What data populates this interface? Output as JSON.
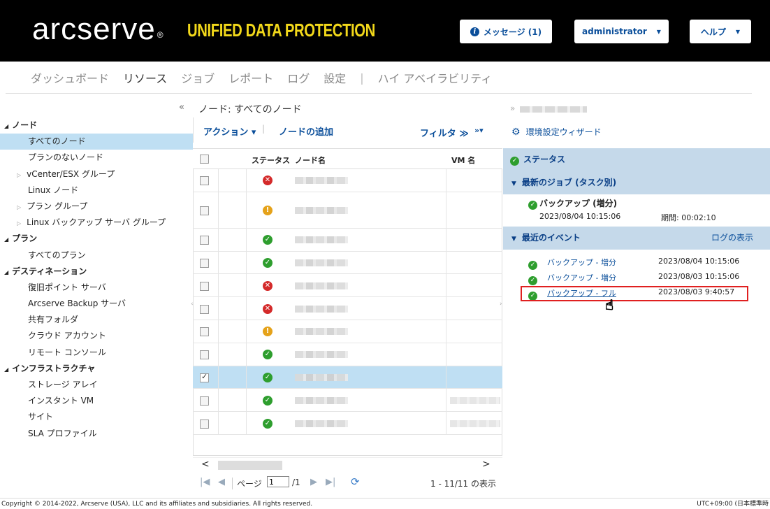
{
  "header": {
    "logo": "arcserve",
    "logo_mark": "®",
    "product": "UNIFIED DATA PROTECTION",
    "messages_label": "メッセージ (1)",
    "user_label": "administrator",
    "help_label": "ヘルプ"
  },
  "menu": {
    "items": [
      "ダッシュボード",
      "リソース",
      "ジョブ",
      "レポート",
      "ログ",
      "設定"
    ],
    "separator": "|",
    "ha": "ハイ アベイラビリティ",
    "active": "リソース"
  },
  "left": {
    "collapse": "«",
    "tree": [
      {
        "label": "ノード",
        "type": "hd"
      },
      {
        "label": "すべてのノード",
        "type": "it",
        "selected": true
      },
      {
        "label": "プランのないノード",
        "type": "it"
      },
      {
        "label": "vCenter/ESX グループ",
        "type": "it",
        "expand": true
      },
      {
        "label": "Linux ノード",
        "type": "it"
      },
      {
        "label": "プラン グループ",
        "type": "it",
        "expand": true
      },
      {
        "label": "Linux バックアップ サーバ グループ",
        "type": "it",
        "expand": true
      },
      {
        "label": "プラン",
        "type": "hd"
      },
      {
        "label": "すべてのプラン",
        "type": "it"
      },
      {
        "label": "デスティネーション",
        "type": "hd"
      },
      {
        "label": "復旧ポイント サーバ",
        "type": "it"
      },
      {
        "label": "Arcserve Backup サーバ",
        "type": "it"
      },
      {
        "label": "共有フォルダ",
        "type": "it"
      },
      {
        "label": "クラウド アカウント",
        "type": "it"
      },
      {
        "label": "リモート コンソール",
        "type": "it"
      },
      {
        "label": "インフラストラクチャ",
        "type": "hd"
      },
      {
        "label": "ストレージ アレイ",
        "type": "it"
      },
      {
        "label": "インスタント VM",
        "type": "it"
      },
      {
        "label": "サイト",
        "type": "it"
      },
      {
        "label": "SLA プロファイル",
        "type": "it"
      }
    ]
  },
  "mid": {
    "title": "ノード: すべてのノード",
    "actions": "アクション ▾",
    "sep": "|",
    "add_node": "ノードの追加",
    "filter": "フィルタ ≫",
    "more": "»▾",
    "col_status": "ステータス",
    "col_name": "ノード名",
    "col_vm": "VM 名",
    "rows": [
      {
        "status": "err",
        "checked": false,
        "selected": false
      },
      {
        "status": "warn",
        "checked": false,
        "selected": false
      },
      {
        "status": "ok",
        "checked": false,
        "selected": false
      },
      {
        "status": "ok",
        "checked": false,
        "selected": false
      },
      {
        "status": "err",
        "checked": false,
        "selected": false
      },
      {
        "status": "err",
        "checked": false,
        "selected": false
      },
      {
        "status": "warn",
        "checked": false,
        "selected": false
      },
      {
        "status": "ok",
        "checked": false,
        "selected": false
      },
      {
        "status": "ok",
        "checked": true,
        "selected": true
      },
      {
        "status": "ok",
        "checked": false,
        "selected": false
      },
      {
        "status": "ok",
        "checked": false,
        "selected": false
      }
    ],
    "pager": {
      "page_label": "ページ",
      "page_value": "1",
      "of": "/1",
      "count": "1 - 11/11 の表示"
    }
  },
  "right": {
    "crumb": "»",
    "wizard": "環境設定ウィザード",
    "status_header": "ステータス",
    "latest_jobs_header": "最新のジョブ (タスク別)",
    "job_title": "バックアップ (増分)",
    "job_date": "2023/08/04 10:15:06",
    "job_period": "期間: 00:02:10",
    "events_header": "最近のイベント",
    "show_log": "ログの表示",
    "events": [
      {
        "label": "バックアップ - 増分",
        "time": "2023/08/04 10:15:06"
      },
      {
        "label": "バックアップ - 増分",
        "time": "2023/08/03 10:15:06"
      },
      {
        "label": "バックアップ - フル",
        "time": "2023/08/03 9:40:57"
      }
    ]
  },
  "footer": {
    "copyright": "Copyright © 2014-2022, Arcserve (USA), LLC and its affiliates and subsidiaries. All rights reserved.",
    "timezone": "UTC+09:00 (日本標準時"
  }
}
